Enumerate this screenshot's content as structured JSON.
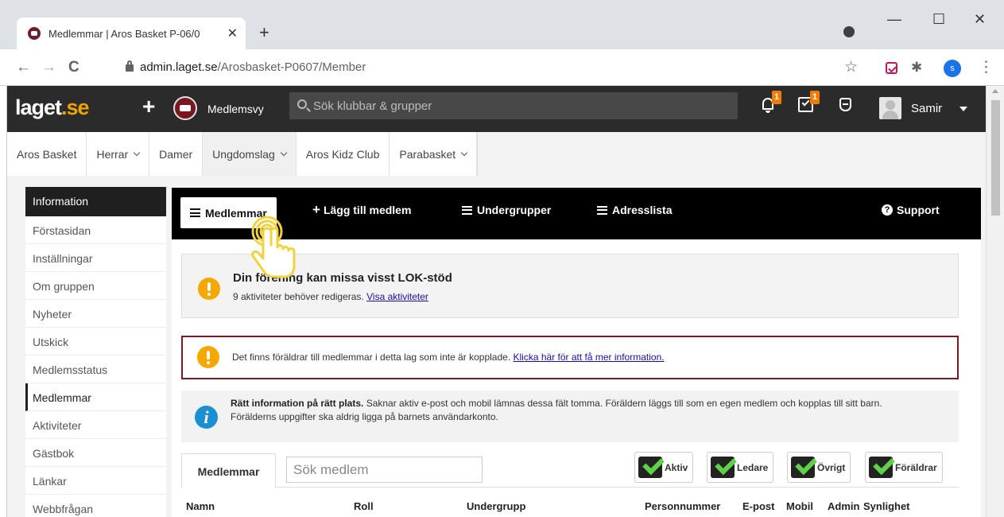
{
  "browser": {
    "tab_title": "Medlemmar | Aros Basket P-06/0",
    "tab_close": "✕",
    "new_tab": "+",
    "url_host": "admin.laget.se",
    "url_path": "/Arosbasket-P0607/Member",
    "profile_initial": "s",
    "window": {
      "minimize": "—",
      "maximize": "☐",
      "close": "✕"
    },
    "nav": {
      "back": "←",
      "forward": "→",
      "reload": "C"
    }
  },
  "site": {
    "logo_main": "laget",
    "logo_suffix": ".se",
    "add": "+",
    "view_label": "Medlemsvy",
    "search_placeholder": "Sök klubbar & grupper",
    "notifications_badge": "1",
    "tasks_badge": "1",
    "user_name": "Samir"
  },
  "nav": {
    "items": [
      {
        "label": "Aros Basket",
        "dropdown": false
      },
      {
        "label": "Herrar",
        "dropdown": true
      },
      {
        "label": "Damer",
        "dropdown": false
      },
      {
        "label": "Ungdomslag",
        "dropdown": true
      },
      {
        "label": "Aros Kidz Club",
        "dropdown": false
      },
      {
        "label": "Parabasket",
        "dropdown": true
      }
    ]
  },
  "sidebar": {
    "header": "Information",
    "items": [
      "Förstasidan",
      "Inställningar",
      "Om gruppen",
      "Nyheter",
      "Utskick",
      "Medlemsstatus",
      "Medlemmar",
      "Aktiviteter",
      "Gästbok",
      "Länkar",
      "Webbfrågan"
    ],
    "active": "Medlemmar"
  },
  "subnav": {
    "members": "Medlemmar",
    "add_member": "Lägg till medlem",
    "subgroups": "Undergrupper",
    "address_list": "Adresslista",
    "support": "Support"
  },
  "notices": {
    "lok_title": "Din förening kan missa visst LOK-stöd",
    "lok_text": "9 aktiviteter behöver redigeras.",
    "lok_link": "Visa aktiviteter",
    "parents_text": "Det finns föräldrar till medlemmar i detta lag som inte är kopplade.",
    "parents_link": "Klicka här för att få mer information.",
    "info_bold": "Rätt information på rätt plats.",
    "info_text": "Saknar aktiv e-post och mobil lämnas dessa fält tomma. Föräldern läggs till som en egen medlem och kopplas till sitt barn. Förälderns uppgifter ska aldrig ligga på barnets användarkonto."
  },
  "members": {
    "tab_label": "Medlemmar",
    "search_placeholder": "Sök medlem",
    "filters": [
      "Aktiv",
      "Ledare",
      "Övrigt",
      "Föräldrar"
    ],
    "columns": [
      "Namn",
      "Roll",
      "Undergrupp",
      "Personnummer",
      "E-post",
      "Mobil",
      "Admin",
      "Synlighet"
    ]
  }
}
